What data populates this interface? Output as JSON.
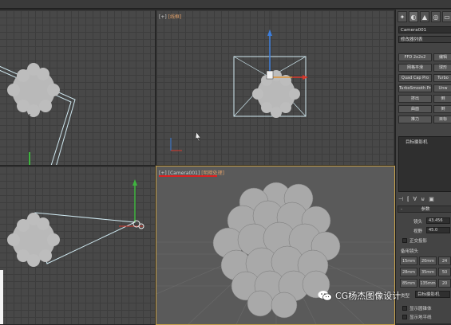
{
  "topbar": {
    "items": [
      "",
      "",
      ""
    ]
  },
  "viewports": {
    "top_right": {
      "label_prefix": "[+]",
      "label_mode": "[线框]"
    },
    "persp": {
      "label_prefix": "[+]",
      "label_cam": "[Camera001]",
      "label_mode": "[明暗处理]"
    }
  },
  "panel": {
    "tabs": [
      "✦",
      "◐",
      "▲",
      "◎",
      "▭",
      "✎"
    ],
    "object_name": "Camera001",
    "modifier_list": "修改器列表",
    "buttons": [
      [
        "FFD 2x2x2",
        "编辑"
      ],
      [
        "网格平滑",
        "球形"
      ],
      [
        "Quad Cap Pro",
        "Turbo"
      ],
      [
        "TurboSmooth Pro",
        "Unw"
      ],
      [
        "挤出",
        "倒"
      ],
      [
        "曲面",
        "倒"
      ],
      [
        "推力",
        "目标"
      ]
    ],
    "stack_item": "目标摄影机",
    "iconbar": [
      "⊣",
      "⫿",
      "∀",
      "⊌",
      "▣"
    ],
    "params_title": "参数",
    "lens_label": "镜头",
    "lens_value": "43.456",
    "fov_label": "视野",
    "fov_value": "45.0",
    "ortho_label": "正交投影",
    "stock_label": "备用镜头",
    "stock_lenses": [
      "15mm",
      "20mm",
      "24",
      "28mm",
      "35mm",
      "50",
      "85mm",
      "135mm",
      "20"
    ],
    "type_label": "类型",
    "type_value": "目标摄影机",
    "cone_label": "显示圆锥体",
    "horizon_label": "显示地平线"
  },
  "watermark": {
    "text": "CG杨杰图像设计"
  },
  "colors": {
    "active_border": "#c8a24a",
    "gizmo_red": "#d8372b",
    "gizmo_green": "#3fb43f",
    "gizmo_blue": "#3d7fdd"
  }
}
